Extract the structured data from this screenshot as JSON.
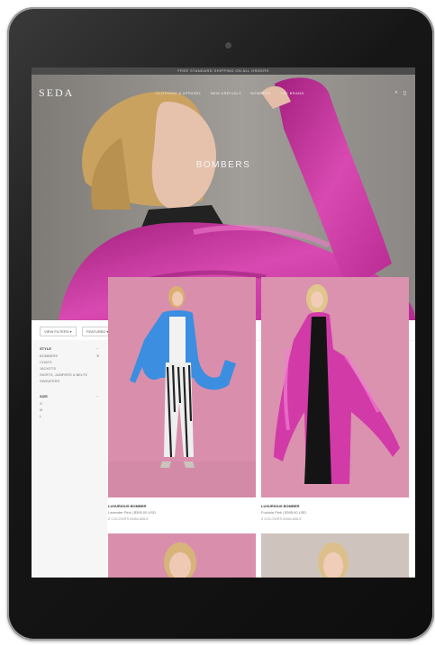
{
  "device": {
    "type": "tablet"
  },
  "site": {
    "announcement": "FREE STANDARD SHIPPING ON ALL ORDERS",
    "logo": "SEDA",
    "nav": [
      "CLOTHING & APPAREL",
      "NEW ARRIVALS",
      "BOMBERS",
      "THE BRAND"
    ],
    "icons": [
      "search-icon",
      "cart-icon"
    ]
  },
  "hero": {
    "title": "BOMBERS"
  },
  "toolbar": {
    "filter_1": "VIEW FILTERS ▾",
    "filter_2": "FEATURED ▾",
    "view_icons": [
      "grid-4-icon",
      "grid-9-icon",
      "list-icon"
    ]
  },
  "sidebar": {
    "style": {
      "heading": "STYLE",
      "toggle": "−",
      "items": [
        "BOMBERS",
        "COATS",
        "JACKETS",
        "SKIRTS, JUMPERS & BELTS",
        "SWEATERS"
      ],
      "selected_toggle": "✕"
    },
    "size": {
      "heading": "SIZE",
      "toggle": "−",
      "items": [
        "S",
        "M",
        "L"
      ]
    }
  },
  "products": [
    {
      "name": "LUXURIOUS BOMBER",
      "price": "Lavender Pink | $395.00 USD",
      "colors": "2 COLOURS AVAILABLE",
      "image": "blue-bomber"
    },
    {
      "name": "LUXURIOUS BOMBER",
      "price": "Fuchsia Pink | $395.00 USD",
      "colors": "2 COLOURS AVAILABLE",
      "image": "pink-bomber"
    },
    {
      "name": "",
      "price": "",
      "colors": "",
      "image": "model-3"
    },
    {
      "name": "",
      "price": "",
      "colors": "",
      "image": "model-4"
    }
  ]
}
